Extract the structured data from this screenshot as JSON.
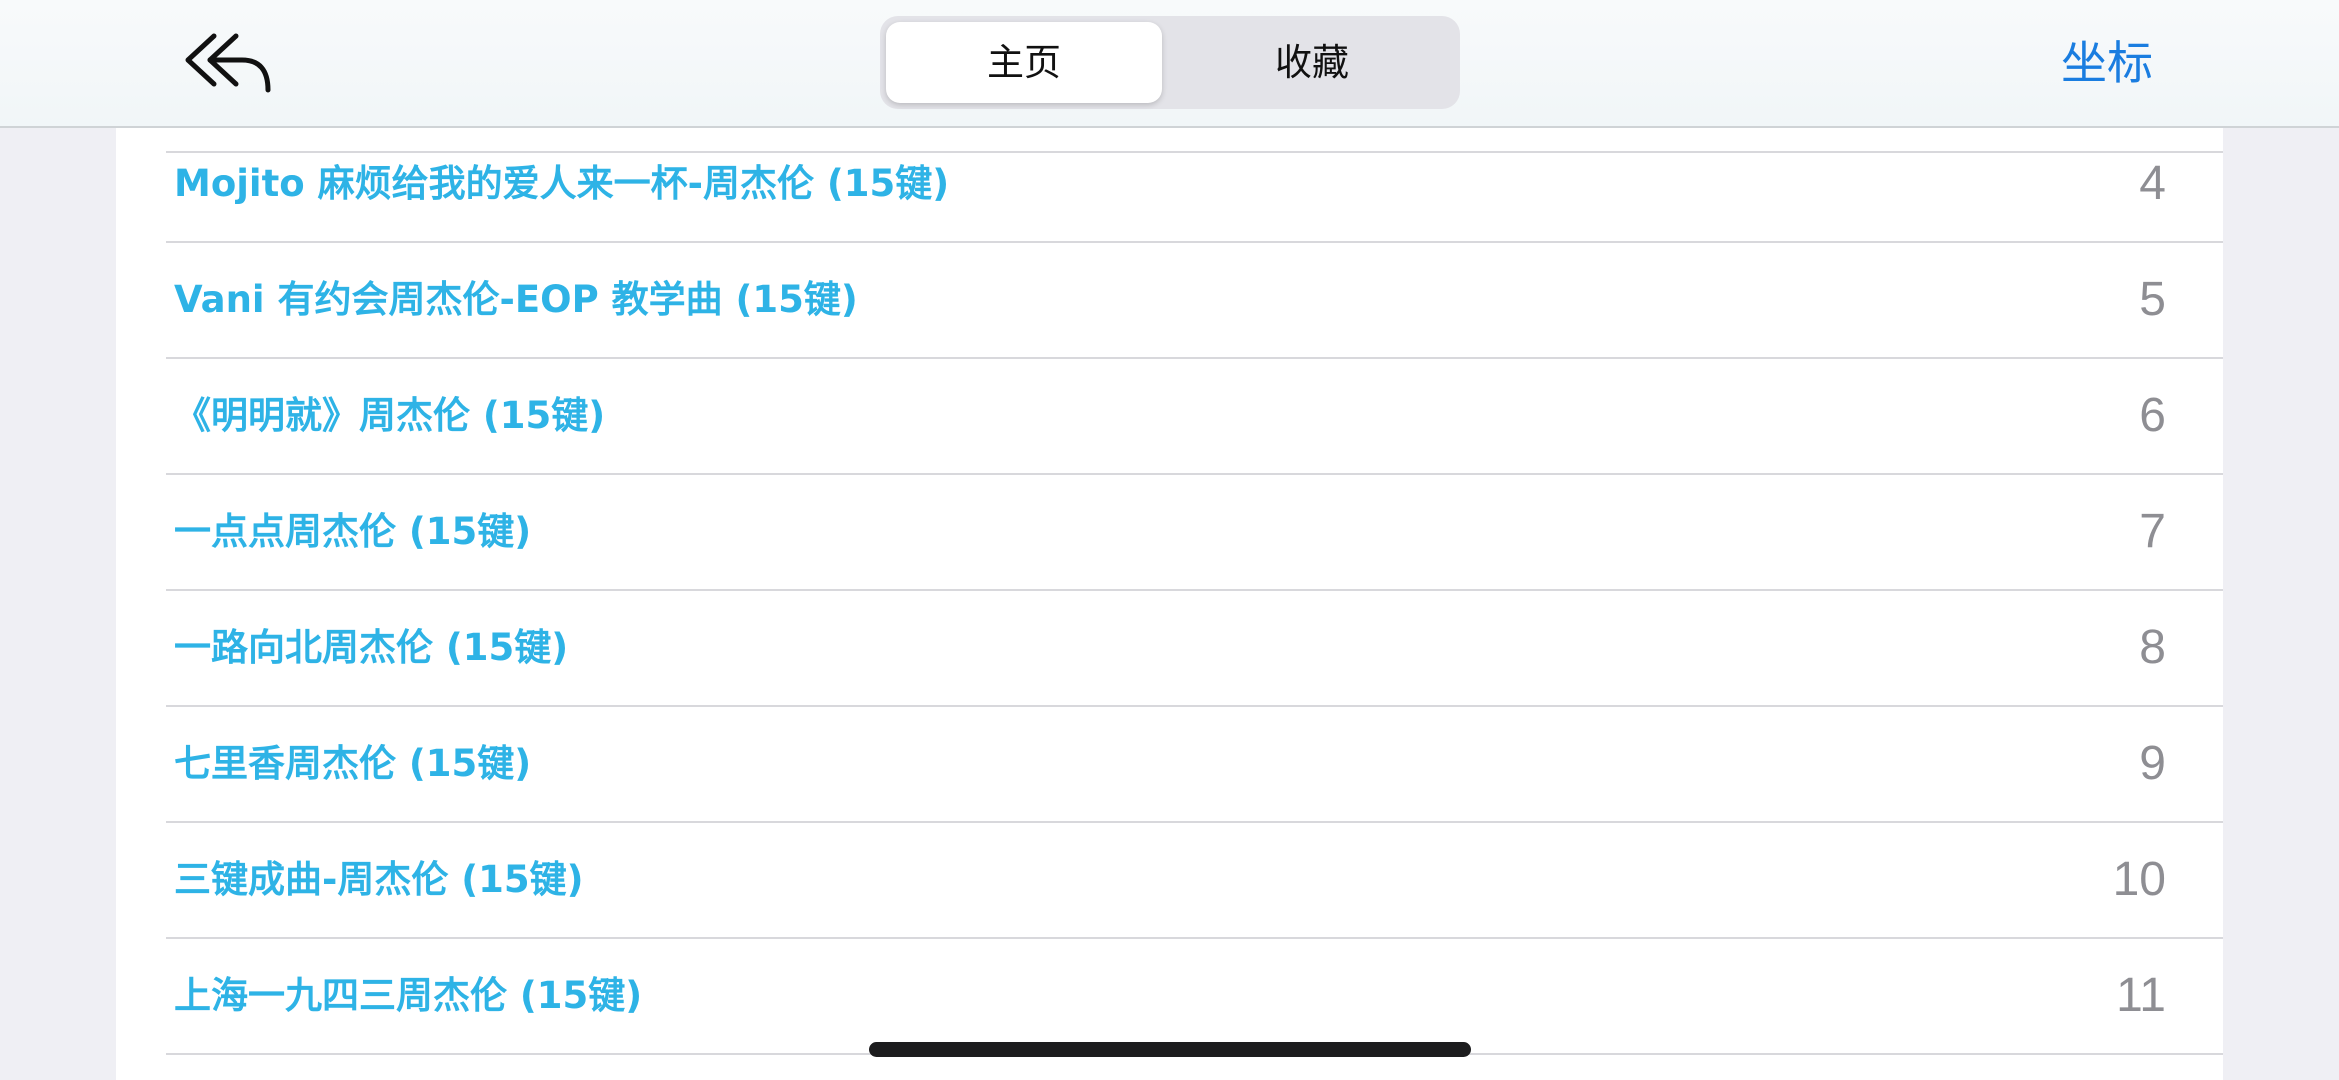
{
  "navbar": {
    "back_icon": "double-back-arrow-icon",
    "segments": [
      {
        "label": "主页",
        "active": true
      },
      {
        "label": "收藏",
        "active": false
      }
    ],
    "right_action": "坐标",
    "accent_color": "#1a7de0"
  },
  "list": {
    "title_color": "#2eb3e6",
    "items": [
      {
        "title": "Mojito 麻烦给我的爱人来一杯-周杰伦 (15键)",
        "count": "4"
      },
      {
        "title": "Vani 有约会周杰伦-EOP 教学曲 (15键)",
        "count": "5"
      },
      {
        "title": "《明明就》周杰伦 (15键)",
        "count": "6"
      },
      {
        "title": "一点点周杰伦 (15键)",
        "count": "7"
      },
      {
        "title": "一路向北周杰伦 (15键)",
        "count": "8"
      },
      {
        "title": "七里香周杰伦 (15键)",
        "count": "9"
      },
      {
        "title": "三键成曲-周杰伦 (15键)",
        "count": "10"
      },
      {
        "title": "上海一九四三周杰伦 (15键)",
        "count": "11"
      }
    ]
  }
}
